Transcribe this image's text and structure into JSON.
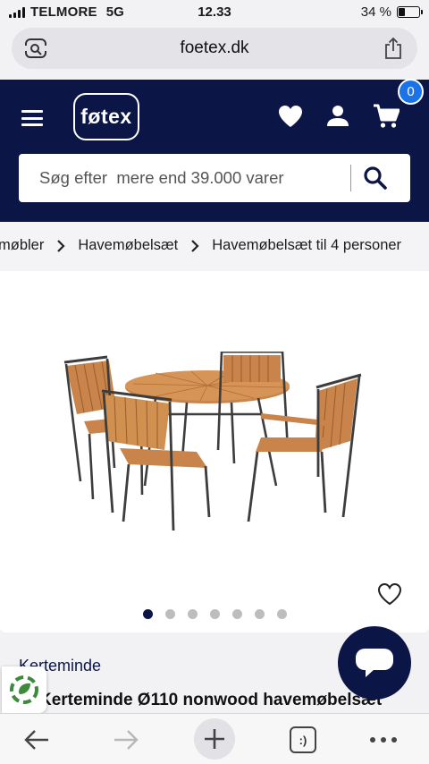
{
  "status_bar": {
    "carrier": "TELMORE",
    "network": "5G",
    "time": "12.33",
    "battery_label": "34 %",
    "battery_level": 0.34
  },
  "browser": {
    "domain": "foetex.dk"
  },
  "header": {
    "logo_text": "føtex",
    "cart_count": "0",
    "search_placeholder": "Søg efter  mere end 39.000 varer",
    "bg_color": "#0b1646"
  },
  "breadcrumb": {
    "items": [
      "møbler",
      "Havemøbelsæt",
      "Havemøbelsæt til 4 personer"
    ]
  },
  "gallery": {
    "image_alt": "havemøbelsæt-image",
    "dot_count": 7,
    "active_index": 0
  },
  "product": {
    "brand": "Kerteminde",
    "title": "Kerteminde Ø110 nonwood havemøbelsæt"
  },
  "toolbar": {
    "tabs_label": ":)"
  }
}
